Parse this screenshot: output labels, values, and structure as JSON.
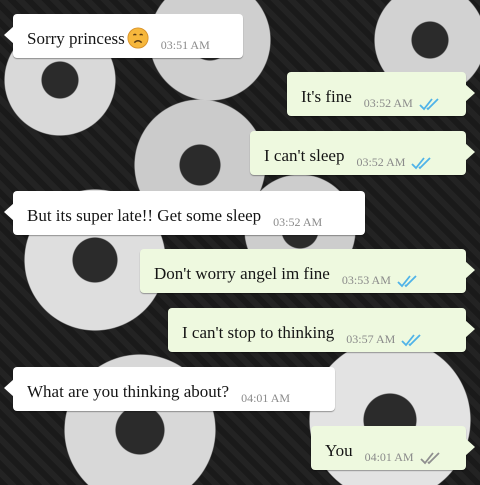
{
  "messages": [
    {
      "side": "in",
      "text": "Sorry princess",
      "time": "03:51 AM",
      "emoji": "disappointed-face-emoji"
    },
    {
      "side": "out",
      "text": "It's fine",
      "time": "03:52 AM",
      "ticks": "double-check-blue"
    },
    {
      "side": "out",
      "text": "I can't sleep",
      "time": "03:52 AM",
      "ticks": "double-check-blue"
    },
    {
      "side": "in",
      "text": "But its super late!! Get some sleep",
      "time": "03:52 AM"
    },
    {
      "side": "out",
      "text": "Don't worry angel im fine",
      "time": "03:53 AM",
      "ticks": "double-check-blue"
    },
    {
      "side": "out",
      "text": "I can't stop to thinking",
      "time": "03:57 AM",
      "ticks": "double-check-blue"
    },
    {
      "side": "in",
      "text": "What are you thinking about?",
      "time": "04:01 AM"
    },
    {
      "side": "out",
      "text": "You",
      "time": "04:01 AM",
      "ticks": "double-check-gray"
    }
  ],
  "colors": {
    "incoming_bubble": "#ffffff",
    "outgoing_bubble": "#eef9df",
    "read_ticks": "#4fb3e8",
    "sent_ticks": "#8f8f8f",
    "timestamp": "#8a8a8a"
  }
}
